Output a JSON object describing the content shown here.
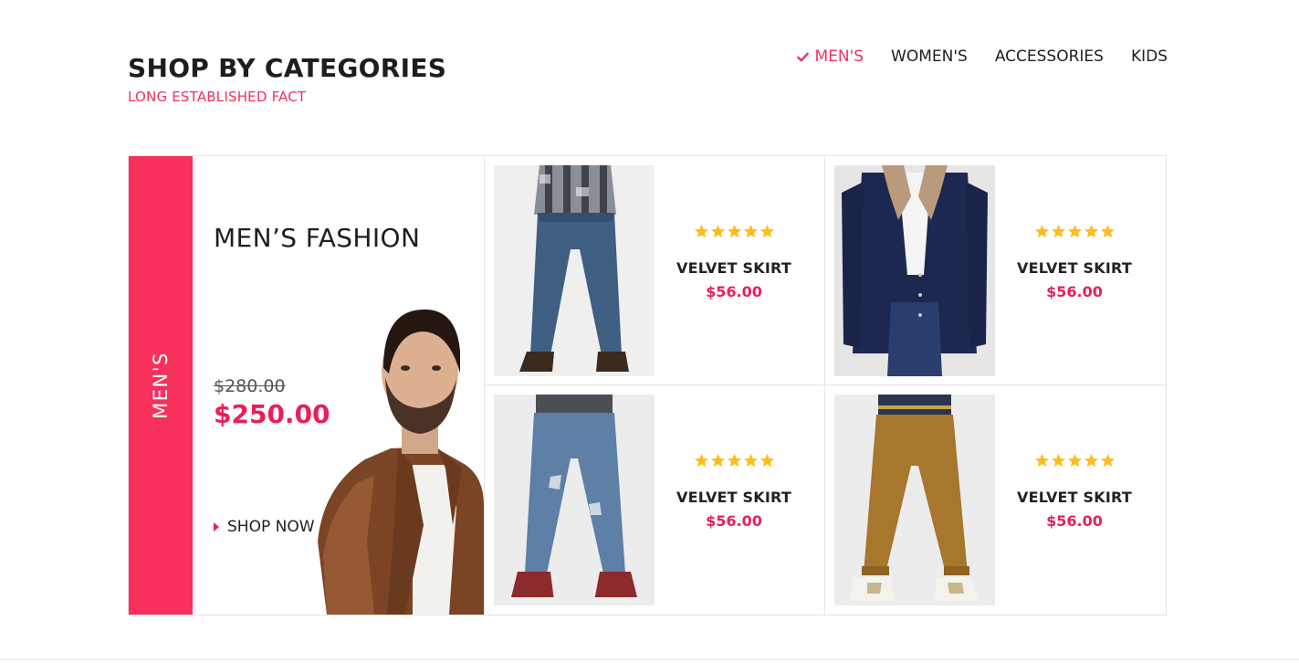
{
  "section": {
    "title": "SHOP BY CATEGORIES",
    "subtitle": "LONG ESTABLISHED FACT"
  },
  "nav": {
    "tabs": [
      {
        "label": "MEN'S",
        "active": true
      },
      {
        "label": "WOMEN'S",
        "active": false
      },
      {
        "label": "ACCESSORIES",
        "active": false
      },
      {
        "label": "KIDS",
        "active": false
      }
    ]
  },
  "feature": {
    "side_label": "MEN'S",
    "title": "MEN’S FASHION",
    "old_price": "$280.00",
    "new_price": "$250.00",
    "cta": "SHOP NOW"
  },
  "products": [
    {
      "name": "VELVET SKIRT",
      "price": "$56.00",
      "rating": 5
    },
    {
      "name": "VELVET SKIRT",
      "price": "$56.00",
      "rating": 5
    },
    {
      "name": "VELVET SKIRT",
      "price": "$56.00",
      "rating": 5
    },
    {
      "name": "VELVET SKIRT",
      "price": "$56.00",
      "rating": 5
    }
  ],
  "colors": {
    "accent": "#f7305c",
    "price": "#e8205a",
    "star": "#f9bf1f"
  }
}
